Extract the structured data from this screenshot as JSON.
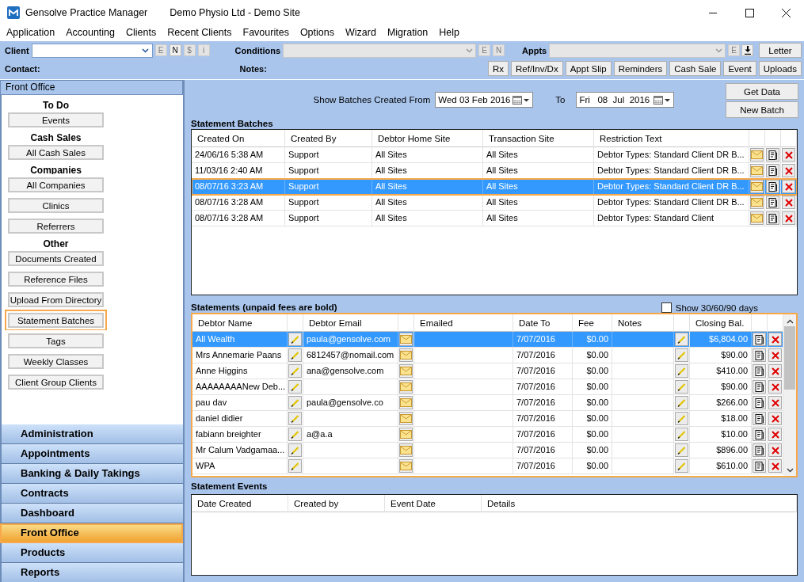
{
  "window": {
    "title": "Gensolve Practice Manager",
    "subtitle": "Demo Physio Ltd - Demo Site"
  },
  "menu": [
    "Application",
    "Accounting",
    "Clients",
    "Recent Clients",
    "Favourites",
    "Options",
    "Wizard",
    "Migration",
    "Help"
  ],
  "toolbar": {
    "client": {
      "label": "Client",
      "disabled": false,
      "buttons": [
        {
          "label": "E",
          "disabled": true
        },
        {
          "label": "N",
          "disabled": false
        },
        {
          "label": "$",
          "disabled": true
        },
        {
          "label": "i",
          "disabled": true
        }
      ]
    },
    "conditions": {
      "label": "Conditions",
      "disabled": true,
      "buttons": [
        {
          "label": "E",
          "disabled": true
        },
        {
          "label": "N",
          "disabled": true
        }
      ]
    },
    "appts": {
      "label": "Appts",
      "disabled": true,
      "buttons": [
        {
          "label": "E",
          "disabled": true
        }
      ]
    },
    "letter": "Letter",
    "contact_label": "Contact:",
    "notes_label": "Notes:",
    "actions": [
      "Rx",
      "Ref/Inv/Dx",
      "Appt Slip",
      "Reminders",
      "Cash Sale",
      "Event",
      "Uploads"
    ]
  },
  "sidebar": {
    "header": "Front Office",
    "groups": [
      {
        "heading": "To Do",
        "items": [
          {
            "label": "Events",
            "highlighted": false
          }
        ]
      },
      {
        "heading": "Cash Sales",
        "items": [
          {
            "label": "All Cash Sales",
            "highlighted": false
          }
        ]
      },
      {
        "heading": "Companies",
        "items": [
          {
            "label": "All Companies",
            "highlighted": false
          },
          {
            "label": "Clinics",
            "highlighted": false
          },
          {
            "label": "Referrers",
            "highlighted": false
          }
        ]
      },
      {
        "heading": "Other",
        "items": [
          {
            "label": "Documents Created",
            "highlighted": false
          },
          {
            "label": "Reference Files",
            "highlighted": false
          },
          {
            "label": "Upload From Directory",
            "highlighted": false
          },
          {
            "label": "Statement Batches",
            "highlighted": true
          },
          {
            "label": "Tags",
            "highlighted": false
          },
          {
            "label": "Weekly Classes",
            "highlighted": false
          },
          {
            "label": "Client Group Clients",
            "highlighted": false
          }
        ]
      }
    ],
    "nav": [
      {
        "label": "Administration",
        "selected": false
      },
      {
        "label": "Appointments",
        "selected": false
      },
      {
        "label": "Banking & Daily Takings",
        "selected": false
      },
      {
        "label": "Contracts",
        "selected": false
      },
      {
        "label": "Dashboard",
        "selected": false
      },
      {
        "label": "Front Office",
        "selected": true
      },
      {
        "label": "Products",
        "selected": false
      },
      {
        "label": "Reports",
        "selected": false
      }
    ]
  },
  "filter": {
    "label": "Show Batches Created From",
    "from": "Wed 03 Feb 2016",
    "to_label": "To",
    "to": "Fri   08  Jul  2016",
    "buttons": [
      "Get Data",
      "New Batch"
    ]
  },
  "batches": {
    "title": "Statement Batches",
    "columns": [
      "Created On",
      "Created By",
      "Debtor Home Site",
      "Transaction Site",
      "Restriction Text"
    ],
    "rows": [
      {
        "cells": [
          "24/06/16 5:38 AM",
          "Support",
          "All Sites",
          "All Sites",
          "Debtor Types: Standard Client DR B..."
        ],
        "selected": false
      },
      {
        "cells": [
          "11/03/16 2:40 AM",
          "Support",
          "All Sites",
          "All Sites",
          "Debtor Types: Standard Client DR B..."
        ],
        "selected": false
      },
      {
        "cells": [
          "08/07/16 3:23 AM",
          "Support",
          "All Sites",
          "All Sites",
          "Debtor Types: Standard Client DR B..."
        ],
        "selected": true
      },
      {
        "cells": [
          "08/07/16 3:28 AM",
          "Support",
          "All Sites",
          "All Sites",
          "Debtor Types: Standard Client DR B..."
        ],
        "selected": false
      },
      {
        "cells": [
          "08/07/16 3:28 AM",
          "Support",
          "All Sites",
          "All Sites",
          "Debtor Types: Standard Client"
        ],
        "selected": false
      }
    ]
  },
  "statements": {
    "title": "Statements (unpaid fees are bold)",
    "highlighted": true,
    "show_days": {
      "label": "Show 30/60/90 days",
      "checked": false
    },
    "columns": [
      "Debtor Name",
      "Debtor Email",
      "Emailed",
      "Date To",
      "Fee",
      "Notes",
      "Closing Bal."
    ],
    "rows": [
      {
        "debtor_name": "All Wealth",
        "debtor_email": "paula@gensolve.com",
        "date_to": "7/07/2016",
        "fee": "$0.00",
        "closing_balance": "$6,804.00",
        "selected": true
      },
      {
        "debtor_name": "Mrs Annemarie Paans",
        "debtor_email": "6812457@nomail.com",
        "date_to": "7/07/2016",
        "fee": "$0.00",
        "closing_balance": "$90.00",
        "selected": false
      },
      {
        "debtor_name": "Anne Higgins",
        "debtor_email": "ana@gensolve.com",
        "date_to": "7/07/2016",
        "fee": "$0.00",
        "closing_balance": "$410.00",
        "selected": false
      },
      {
        "debtor_name": "AAAAAAAANew Deb...",
        "date_to": "7/07/2016",
        "fee": "$0.00",
        "closing_balance": "$90.00",
        "selected": false
      },
      {
        "debtor_name": "pau dav",
        "debtor_email": "paula@gensolve.co",
        "date_to": "7/07/2016",
        "fee": "$0.00",
        "closing_balance": "$266.00",
        "selected": false
      },
      {
        "debtor_name": "daniel didier",
        "date_to": "7/07/2016",
        "fee": "$0.00",
        "closing_balance": "$18.00",
        "selected": false
      },
      {
        "debtor_name": "fabiann breighter",
        "debtor_email": "a@a.a",
        "date_to": "7/07/2016",
        "fee": "$0.00",
        "closing_balance": "$10.00",
        "selected": false
      },
      {
        "debtor_name": "Mr Calum Vadgamaa...",
        "date_to": "7/07/2016",
        "fee": "$0.00",
        "closing_balance": "$896.00",
        "selected": false
      },
      {
        "debtor_name": "WPA",
        "date_to": "7/07/2016",
        "fee": "$0.00",
        "closing_balance": "$610.00",
        "selected": false
      }
    ]
  },
  "events": {
    "title": "Statement Events",
    "columns": [
      "Date Created",
      "Created by",
      "Event Date",
      "Details"
    ]
  }
}
